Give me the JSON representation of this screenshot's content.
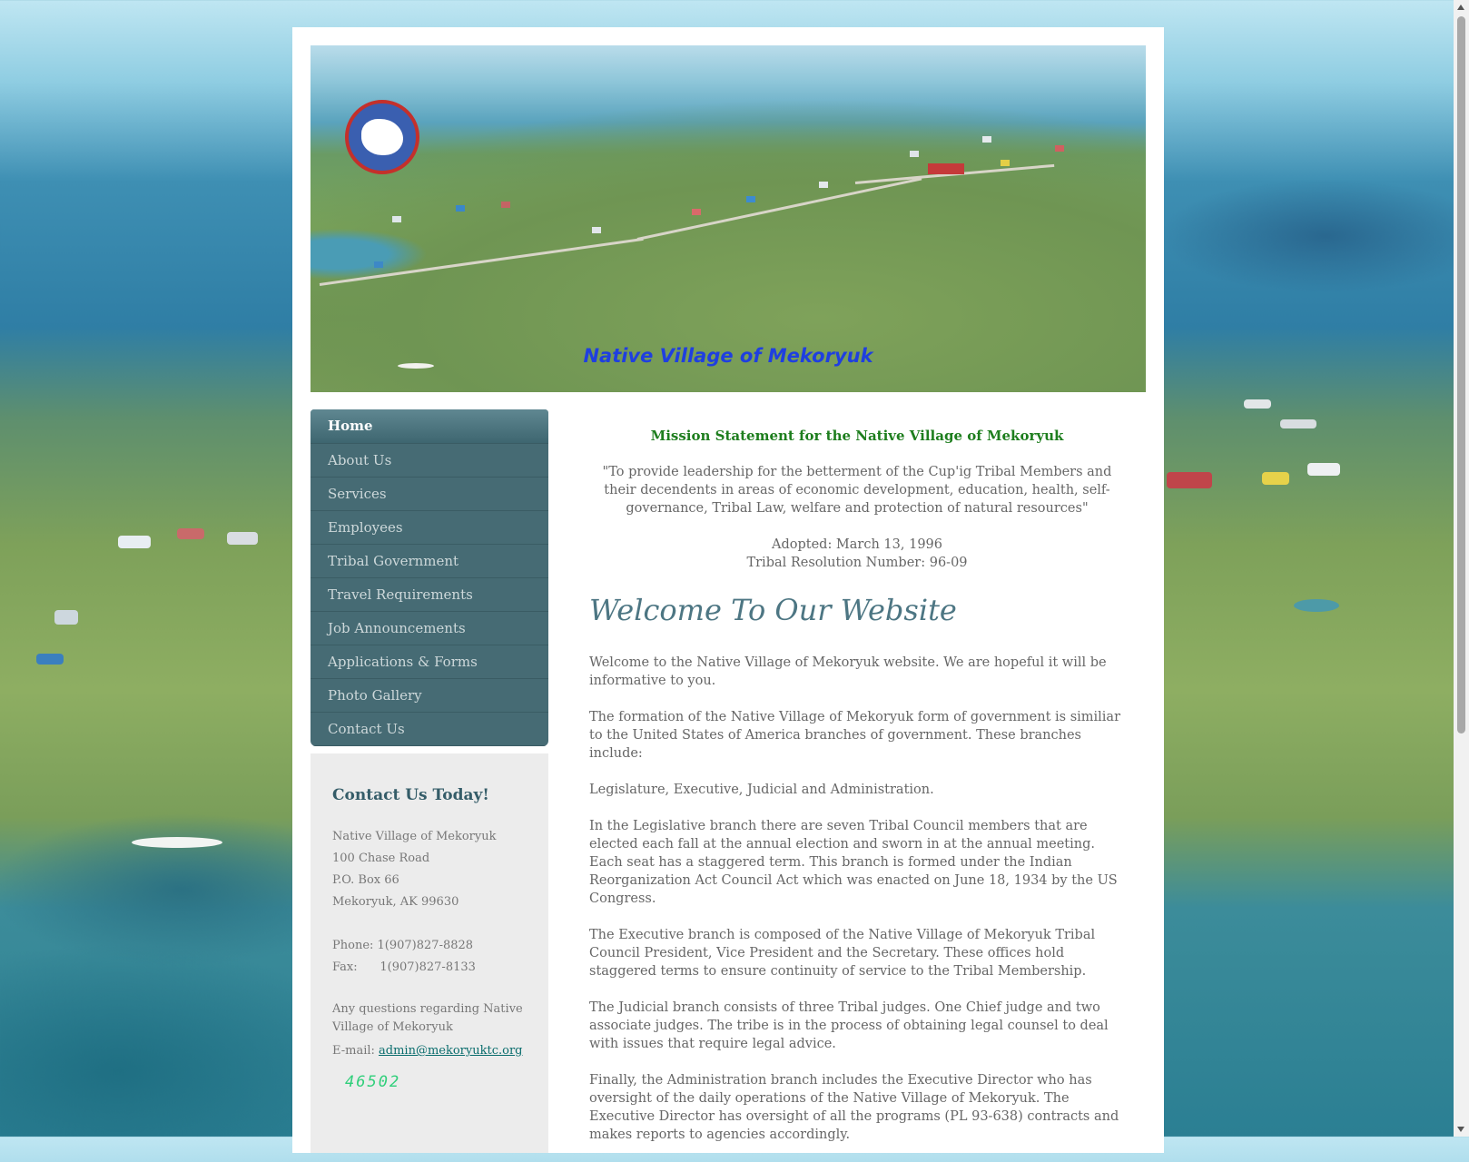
{
  "banner": {
    "title": "Native Village of Mekoryuk"
  },
  "nav": {
    "items": [
      {
        "label": "Home",
        "active": true
      },
      {
        "label": "About Us"
      },
      {
        "label": "Services"
      },
      {
        "label": "Employees"
      },
      {
        "label": "Tribal Government"
      },
      {
        "label": "Travel Requirements"
      },
      {
        "label": "Job Announcements"
      },
      {
        "label": "Applications & Forms"
      },
      {
        "label": "Photo Gallery"
      },
      {
        "label": "Contact Us"
      }
    ]
  },
  "contact": {
    "heading": "Contact Us Today!",
    "org": "Native Village of Mekoryuk",
    "street": "100 Chase Road",
    "pobox": "P.O. Box 66",
    "city": "Mekoryuk, AK 99630",
    "phone": "Phone: 1(907)827-8828",
    "fax": "Fax:      1(907)827-8133",
    "questions": "Any questions regarding Native Village of Mekoryuk",
    "email_label": "E-mail: ",
    "email": "admin@mekoryuktc.org",
    "counter": "46502"
  },
  "main": {
    "mission_title": "Mission Statement for the Native Village of Mekoryuk",
    "mission_quote": "\"To provide leadership for the betterment of the Cup'ig Tribal Members and their decendents in areas of economic development, education, health, self-governance, Tribal Law, welfare and protection of natural resources\"",
    "adopted": "Adopted: March 13, 1996",
    "resolution": "Tribal Resolution Number: 96-09",
    "welcome_heading": "Welcome To Our Website",
    "paragraphs": [
      "Welcome to the Native Village of Mekoryuk website. We are hopeful it will be informative to you.",
      "The formation of the Native Village of Mekoryuk form of government is similiar to the United States of America branches of government. These branches include:",
      "Legislature, Executive, Judicial and Administration.",
      "In the Legislative branch there are seven Tribal Council members that are elected each fall at the annual election and sworn in at the annual meeting. Each seat has a staggered term. This branch is formed under the Indian Reorganization Act Council Act which was enacted on June 18, 1934 by the US Congress.",
      "The Executive branch is composed of the Native Village of Mekoryuk Tribal Council President, Vice President and the Secretary. These offices hold staggered terms to ensure continuity of service to the Tribal Membership.",
      "The Judicial branch consists of three Tribal judges. One Chief judge and two associate judges. The tribe is in the process of obtaining legal counsel to deal with issues that require legal advice.",
      "Finally, the Administration branch includes the Executive Director who has oversight of the daily operations of the Native Village of Mekoryuk. The Executive Director has oversight of all the programs (PL 93-638) contracts and makes reports to agencies accordingly."
    ]
  }
}
